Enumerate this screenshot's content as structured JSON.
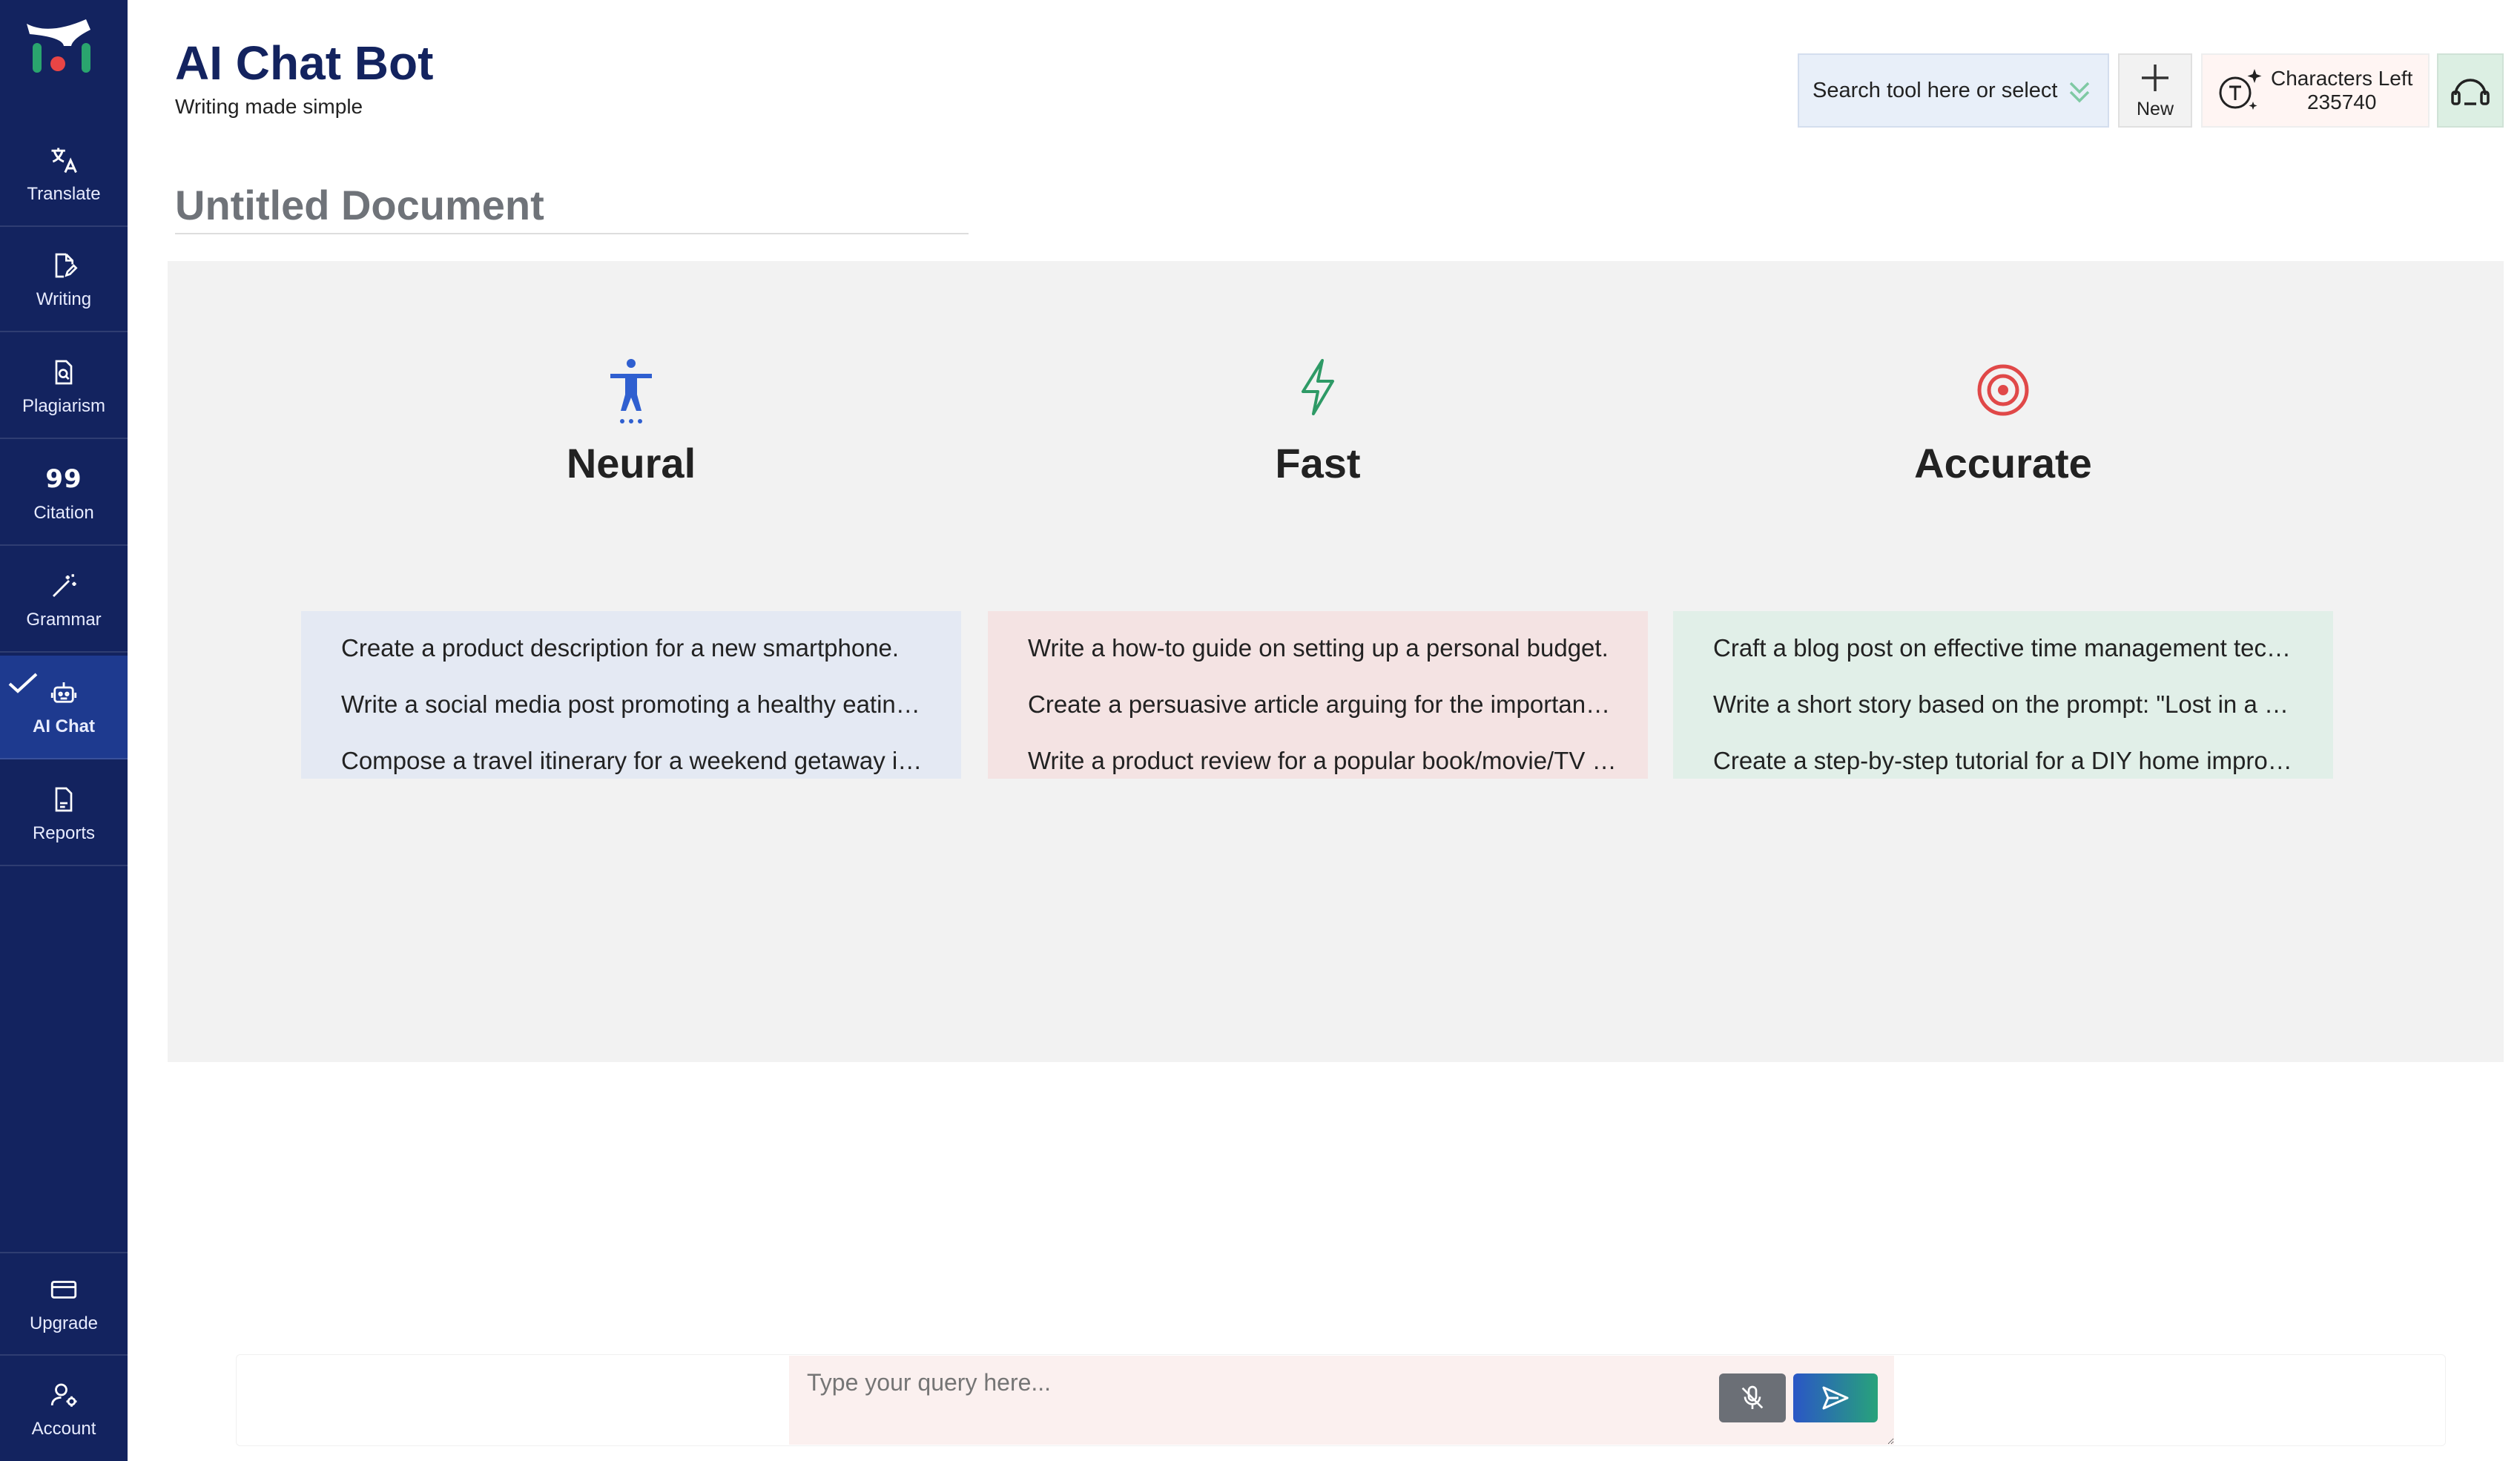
{
  "sidebar": {
    "items": [
      {
        "label": "Translate",
        "icon": "translate-icon"
      },
      {
        "label": "Writing",
        "icon": "document-edit-icon"
      },
      {
        "label": "Plagiarism",
        "icon": "document-search-icon"
      },
      {
        "label": "Citation",
        "icon": "quote-icon"
      },
      {
        "label": "Grammar",
        "icon": "magic-wand-icon"
      },
      {
        "label": "AI Chat",
        "icon": "robot-icon",
        "active": true
      },
      {
        "label": "Reports",
        "icon": "report-icon"
      }
    ],
    "bottom_items": [
      {
        "label": "Upgrade",
        "icon": "card-icon"
      },
      {
        "label": "Account",
        "icon": "user-gear-icon"
      }
    ],
    "citation_glyph": "99"
  },
  "header": {
    "title": "AI Chat Bot",
    "subtitle": "Writing made simple",
    "search_text": "Search tool here or select",
    "new_label": "New",
    "chars_label": "Characters Left",
    "chars_value": "235740"
  },
  "document": {
    "title": "Untitled Document"
  },
  "features": [
    {
      "title": "Neural",
      "icon": "accessibility-person-icon",
      "prompts": [
        "Create a product description for a new smartphone.",
        "Write a social media post promoting a healthy eating…",
        "Compose a travel itinerary for a weekend getaway in …"
      ]
    },
    {
      "title": "Fast",
      "icon": "lightning-icon",
      "prompts": [
        "Write a how-to guide on setting up a personal budget.",
        "Create a persuasive article arguing for the importanc…",
        "Write a product review for a popular book/movie/TV …"
      ]
    },
    {
      "title": "Accurate",
      "icon": "target-icon",
      "prompts": [
        "Craft a blog post on effective time management tec…",
        "Write a short story based on the prompt: \"Lost in a m…",
        "Create a step-by-step tutorial for a DIY home improv…"
      ]
    }
  ],
  "chat": {
    "placeholder": "Type your query here..."
  },
  "colors": {
    "sidebar": "#13235f",
    "neural_bg": "#e4e9f3",
    "fast_bg": "#f4e3e3",
    "accurate_bg": "#e1efe8",
    "neural_icon": "#2f5fd0",
    "fast_icon": "#2e9a66",
    "accurate_icon": "#e04848"
  }
}
